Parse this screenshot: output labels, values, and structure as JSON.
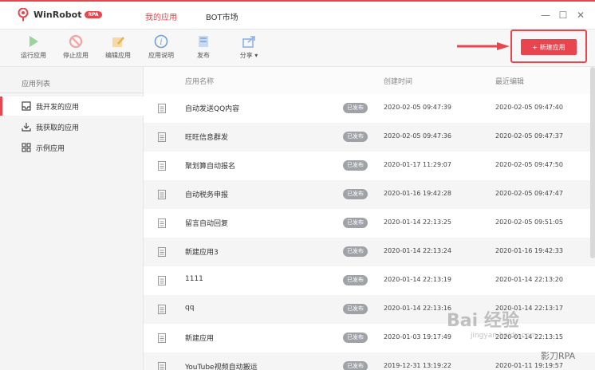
{
  "app": {
    "name": "WinRobot",
    "badge": "RPA",
    "accent": "#e8454f"
  },
  "top_tabs": [
    {
      "label": "我的应用",
      "active": true
    },
    {
      "label": "BOT市场",
      "active": false
    }
  ],
  "window_controls": {
    "minimize": "—",
    "maximize": "☐",
    "close": "✕"
  },
  "toolbar": {
    "run": "运行应用",
    "stop": "停止应用",
    "edit": "编辑应用",
    "info": "应用说明",
    "publish": "发布",
    "share": "分享",
    "new_app": "+ 新建应用"
  },
  "sidebar": {
    "header": "应用列表",
    "items": [
      {
        "label": "我开发的应用",
        "icon": "inbox-icon",
        "active": true
      },
      {
        "label": "我获取的应用",
        "icon": "download-icon",
        "active": false
      },
      {
        "label": "示例应用",
        "icon": "grid-icon",
        "active": false
      }
    ]
  },
  "table": {
    "headers": {
      "name": "应用名称",
      "created": "创建时间",
      "edited": "最近编辑"
    },
    "status_label": "已发布",
    "rows": [
      {
        "name": "自动发送QQ内容",
        "created": "2020-02-05 09:47:39",
        "edited": "2020-02-05 09:47:40"
      },
      {
        "name": "旺旺信息群发",
        "created": "2020-02-05 09:47:36",
        "edited": "2020-02-05 09:47:37"
      },
      {
        "name": "聚划算自动报名",
        "created": "2020-01-17 11:29:07",
        "edited": "2020-02-05 09:47:50"
      },
      {
        "name": "自动税务申报",
        "created": "2020-01-16 19:42:28",
        "edited": "2020-02-05 09:47:47"
      },
      {
        "name": "留言自动回复",
        "created": "2020-01-14 22:13:25",
        "edited": "2020-02-05 09:51:05"
      },
      {
        "name": "新建应用3",
        "created": "2020-01-14 22:13:24",
        "edited": "2020-01-16 19:42:33"
      },
      {
        "name": "1111",
        "created": "2020-01-14 22:13:19",
        "edited": "2020-01-14 22:13:20"
      },
      {
        "name": "qq",
        "created": "2020-01-14 22:13:16",
        "edited": "2020-01-14 22:13:17"
      },
      {
        "name": "新建应用",
        "created": "2020-01-03 19:17:49",
        "edited": "2020-01-14 22:13:15"
      },
      {
        "name": "YouTube视频自动搬运",
        "created": "2019-12-31 13:19:22",
        "edited": "2020-01-11 19:19:57"
      }
    ]
  },
  "watermark": {
    "line1": "Bai 经验",
    "line2": "jingyan.baidu.com",
    "line3": "影刀RPA"
  }
}
